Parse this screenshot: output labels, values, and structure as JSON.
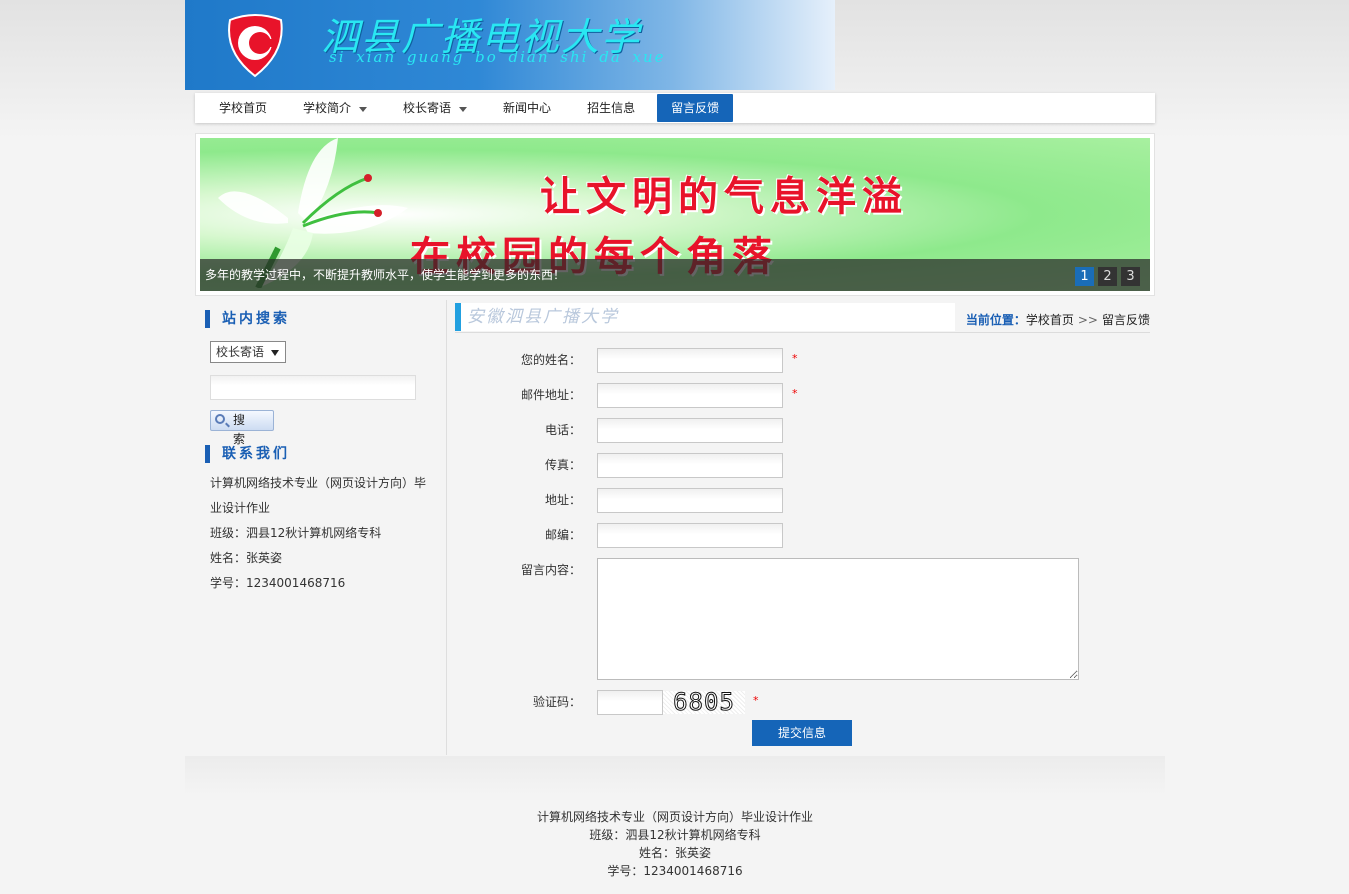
{
  "header": {
    "title": "泗县广播电视大学",
    "pinyin": "si xian guang bo dian shi da xue",
    "logo_letter": "C"
  },
  "nav": {
    "items": [
      {
        "label": "学校首页",
        "has_dropdown": false,
        "active": false
      },
      {
        "label": "学校简介",
        "has_dropdown": true,
        "active": false
      },
      {
        "label": "校长寄语",
        "has_dropdown": true,
        "active": false
      },
      {
        "label": "新闻中心",
        "has_dropdown": false,
        "active": false
      },
      {
        "label": "招生信息",
        "has_dropdown": false,
        "active": false
      },
      {
        "label": "留言反馈",
        "has_dropdown": false,
        "active": true
      }
    ]
  },
  "banner": {
    "line1": "让文明的气息洋溢",
    "line2": "在校园的每个角落",
    "caption": "多年的教学过程中，不断提升教师水平，使学生能学到更多的东西！",
    "pages": [
      "1",
      "2",
      "3"
    ],
    "active_page": "1"
  },
  "sidebar": {
    "search_heading": "站内搜索",
    "search_select_value": "校长寄语",
    "search_input_value": "",
    "search_button": "搜 索",
    "contact_heading": "联系我们",
    "contact_lines": [
      "计算机网络技术专业（网页设计方向）毕业设计作业",
      "班级：泗县12秋计算机网络专科",
      "姓名：张英姿",
      "学号：1234001468716"
    ]
  },
  "main": {
    "section_title": "安徽泗县广播大学",
    "location_label": "当前位置：",
    "location_home": "学校首页",
    "location_sep": ">>",
    "location_current": "留言反馈",
    "form": {
      "name_label": "您的姓名：",
      "email_label": "邮件地址：",
      "phone_label": "电话：",
      "fax_label": "传真：",
      "address_label": "地址：",
      "zip_label": "邮编：",
      "message_label": "留言内容：",
      "captcha_label": "验证码：",
      "captcha_code": "6805",
      "required_mark": "*",
      "submit_label": "提交信息"
    }
  },
  "footer": {
    "lines": [
      "计算机网络技术专业（网页设计方向）毕业设计作业",
      "班级：泗县12秋计算机网络专科",
      "姓名：张英姿",
      "学号：1234001468716"
    ]
  },
  "colors": {
    "primary": "#1565b8",
    "accent_title": "#29e7f2",
    "banner_text": "#e8132a",
    "required": "#e00000"
  }
}
